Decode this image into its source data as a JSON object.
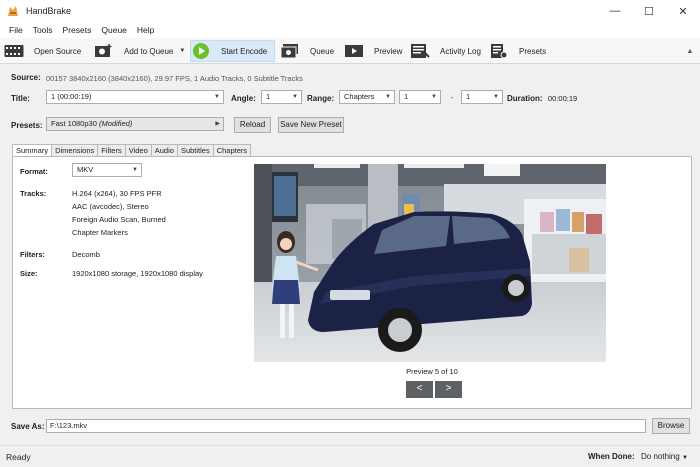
{
  "window": {
    "title": "HandBrake",
    "min": "—",
    "max": "☐",
    "close": "✕"
  },
  "menu": [
    "File",
    "Tools",
    "Presets",
    "Queue",
    "Help"
  ],
  "toolbar": {
    "open_source": "Open Source",
    "add_to_queue": "Add to Queue",
    "start_encode": "Start Encode",
    "queue": "Queue",
    "preview": "Preview",
    "activity_log": "Activity Log",
    "presets": "Presets"
  },
  "source": {
    "label": "Source:",
    "value": "00157  3840x2160 (3840x2160), 29.97 FPS, 1 Audio Tracks, 0 Subtitle Tracks"
  },
  "title_row": {
    "title_label": "Title:",
    "title_value": "1 (00:00:19)",
    "angle_label": "Angle:",
    "angle_value": "1",
    "range_label": "Range:",
    "range_type": "Chapters",
    "range_start": "1",
    "range_dash": "-",
    "range_end": "1",
    "duration_label": "Duration:",
    "duration_value": "00:00:19"
  },
  "presets_row": {
    "label": "Presets:",
    "value": "Fast 1080p30",
    "modified": "(Modified)",
    "reload": "Reload",
    "save_new": "Save New Preset"
  },
  "tabs": [
    "Summary",
    "Dimensions",
    "Filters",
    "Video",
    "Audio",
    "Subtitles",
    "Chapters"
  ],
  "summary": {
    "format_label": "Format:",
    "format_value": "MKV",
    "tracks_label": "Tracks:",
    "tracks": [
      "H.264 (x264), 30 FPS PFR",
      "AAC (avcodec), Stereo",
      "Foreign Audio Scan, Burned",
      "Chapter Markers"
    ],
    "filters_label": "Filters:",
    "filters_value": "Decomb",
    "size_label": "Size:",
    "size_value": "1920x1080 storage, 1920x1080 display"
  },
  "preview": {
    "caption": "Preview 5 of 10",
    "prev": "<",
    "next": ">"
  },
  "save_as": {
    "label": "Save As:",
    "value": "F:\\123.mkv",
    "browse": "Browse"
  },
  "status": {
    "text": "Ready",
    "when_done_label": "When Done:",
    "when_done_value": "Do nothing"
  }
}
